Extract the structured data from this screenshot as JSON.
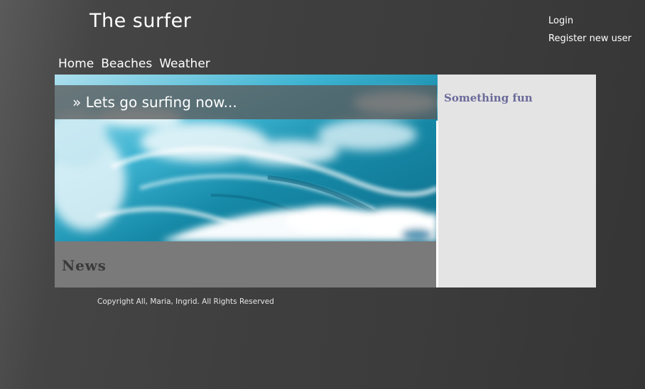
{
  "header": {
    "site_title": "The surfer",
    "login_label": "Login",
    "register_label": "Register new user"
  },
  "nav": {
    "items": [
      {
        "label": "Home"
      },
      {
        "label": "Beaches"
      },
      {
        "label": "Weather"
      }
    ]
  },
  "hero": {
    "banner_text": "» Lets go surfing now...",
    "image_icon": "ocean-wave-photo"
  },
  "main": {
    "news_heading": "News"
  },
  "sidebar": {
    "heading": "Something fun"
  },
  "footer": {
    "copyright": "Copyright All, Maria, Ingrid. All Rights Reserved"
  },
  "colors": {
    "page_background": "#3f3f3f",
    "content_background": "#e4e4e4",
    "news_panel": "#7a7a7a",
    "banner_overlay": "#5a5a5a",
    "sidebar_heading": "#6a6a9a",
    "text_light": "#ffffff"
  }
}
